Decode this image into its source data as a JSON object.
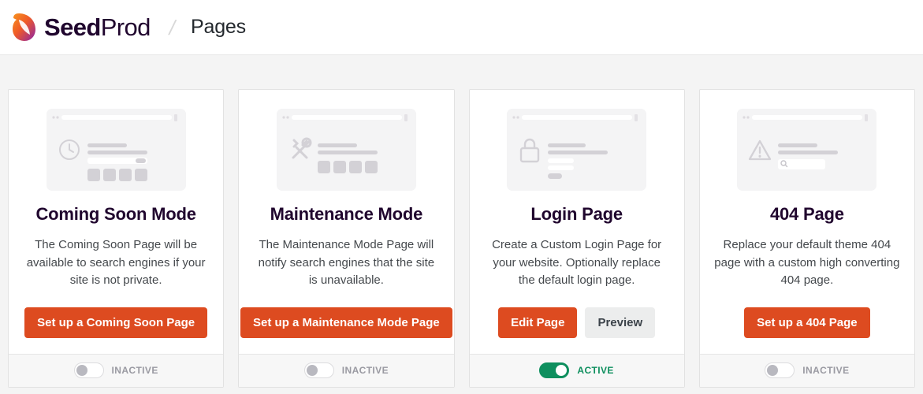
{
  "header": {
    "brand_bold": "Seed",
    "brand_light": "Prod",
    "logo_icon": "seedprod-leaf-logo",
    "separator": "/",
    "page_title": "Pages"
  },
  "colors": {
    "primary_orange": "#dd4b20",
    "active_green": "#0e8f5e",
    "brand_dark": "#20062e",
    "page_bg": "#f4f4f4",
    "card_bg": "#ffffff",
    "footer_bg": "#f7f7f7",
    "thumb_bg": "#f4f4f5",
    "placeholder_gray": "#d3d1d6",
    "inactive_gray": "#9a9aa2"
  },
  "cards": [
    {
      "id": "coming-soon-mode",
      "thumb_icon": "clock-icon",
      "title": "Coming Soon Mode",
      "description": "The Coming Soon Page will be available to search engines if your site is not private.",
      "buttons": [
        {
          "label": "Set up a Coming Soon Page",
          "style": "primary",
          "name": "setup-coming-soon-page-button"
        }
      ],
      "status": {
        "state": "inactive",
        "label": "INACTIVE"
      }
    },
    {
      "id": "maintenance-mode",
      "thumb_icon": "tools-icon",
      "title": "Maintenance Mode",
      "description": "The Maintenance Mode Page will notify search engines that the site is unavailable.",
      "buttons": [
        {
          "label": "Set up a Maintenance Mode Page",
          "style": "primary",
          "name": "setup-maintenance-mode-page-button"
        }
      ],
      "status": {
        "state": "inactive",
        "label": "INACTIVE"
      }
    },
    {
      "id": "login-page",
      "thumb_icon": "lock-icon",
      "title": "Login Page",
      "description": "Create a Custom Login Page for your website. Optionally replace the default login page.",
      "buttons": [
        {
          "label": "Edit Page",
          "style": "primary",
          "name": "edit-login-page-button"
        },
        {
          "label": "Preview",
          "style": "secondary",
          "name": "preview-login-page-button"
        }
      ],
      "status": {
        "state": "active",
        "label": "ACTIVE"
      }
    },
    {
      "id": "404-page",
      "thumb_icon": "warning-triangle-icon",
      "title": "404 Page",
      "description": "Replace your default theme 404 page with a custom high converting 404 page.",
      "buttons": [
        {
          "label": "Set up a 404 Page",
          "style": "primary",
          "name": "setup-404-page-button"
        }
      ],
      "status": {
        "state": "inactive",
        "label": "INACTIVE"
      }
    }
  ]
}
